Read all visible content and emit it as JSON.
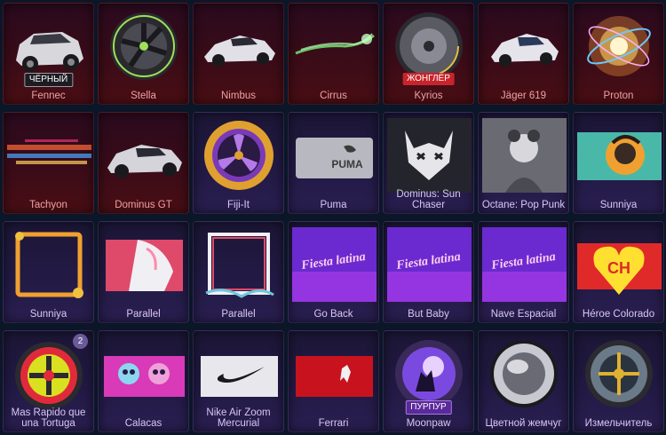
{
  "items": [
    {
      "name": "Fennec",
      "tag": "ЧЁРНЫЙ"
    },
    {
      "name": "Stella"
    },
    {
      "name": "Nimbus"
    },
    {
      "name": "Cirrus"
    },
    {
      "name": "Kyrios",
      "tag": "ЖОНГЛЁР"
    },
    {
      "name": "Jäger 619"
    },
    {
      "name": "Proton"
    },
    {
      "name": "Tachyon"
    },
    {
      "name": "Dominus GT"
    },
    {
      "name": "Fiji-It"
    },
    {
      "name": "Puma",
      "art_text": "PUMA"
    },
    {
      "name": "Dominus: Sun Chaser"
    },
    {
      "name": "Octane: Pop Punk"
    },
    {
      "name": "Sunniya"
    },
    {
      "name": "Sunniya"
    },
    {
      "name": "Parallel"
    },
    {
      "name": "Parallel"
    },
    {
      "name": "Go Back",
      "art_text": "Fiesta latina"
    },
    {
      "name": "But Baby",
      "art_text": "Fiesta latina"
    },
    {
      "name": "Nave Espacial",
      "art_text": "Fiesta latina"
    },
    {
      "name": "Héroe Colorado",
      "art_text": "CH"
    },
    {
      "name": "Mas Rapido que una Tortuga",
      "badge": "2"
    },
    {
      "name": "Calacas"
    },
    {
      "name": "Nike Air Zoom Mercurial"
    },
    {
      "name": "Ferrari"
    },
    {
      "name": "Moonpaw",
      "tag": "ПУРПУР"
    },
    {
      "name": "Цветной жемчуг"
    },
    {
      "name": "Измельчитель"
    }
  ],
  "colors": {
    "background": "#0b1628",
    "tile_red": "#3a0c18",
    "tile_purple": "#221a44",
    "label_red": "#f2a0a0",
    "label_purple": "#d9c6f4"
  }
}
